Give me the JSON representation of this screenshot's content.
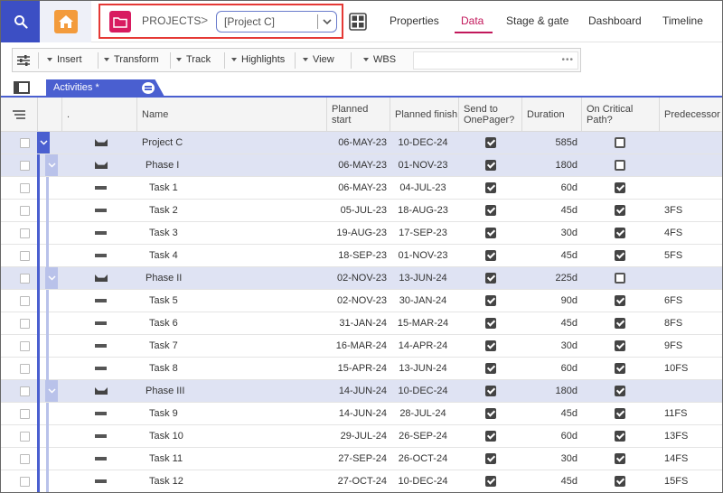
{
  "topbar": {
    "breadcrumb_root": "PROJECTS",
    "breadcrumb_sep": ">",
    "project_value": "[Project C]",
    "tabs": [
      {
        "label": "Properties",
        "active": false
      },
      {
        "label": "Data",
        "active": true
      },
      {
        "label": "Stage & gate",
        "active": false
      },
      {
        "label": "Dashboard",
        "active": false
      },
      {
        "label": "Timeline",
        "active": false
      }
    ]
  },
  "toolbar": {
    "items": [
      "Insert",
      "Transform",
      "Track",
      "Highlights",
      "View",
      "WBS"
    ],
    "more": "•••"
  },
  "sheet_tab": {
    "label": "Activities *"
  },
  "columns": {
    "dot": ".",
    "name": "Name",
    "planned_start": "Planned start",
    "planned_finish": "Planned finish",
    "send_to_onepager": "Send to OnePager?",
    "duration": "Duration",
    "critical_path": "On Critical Path?",
    "predecessor": "Predecessor"
  },
  "rows": [
    {
      "level": 0,
      "type": "summary",
      "name": "Project C",
      "start": "06-MAY-23",
      "finish": "10-DEC-24",
      "send": true,
      "duration": "585d",
      "critical": false,
      "pred": ""
    },
    {
      "level": 1,
      "type": "summary",
      "name": "Phase I",
      "start": "06-MAY-23",
      "finish": "01-NOV-23",
      "send": true,
      "duration": "180d",
      "critical": false,
      "pred": ""
    },
    {
      "level": 2,
      "type": "task",
      "name": "Task 1",
      "start": "06-MAY-23",
      "finish": "04-JUL-23",
      "send": true,
      "duration": "60d",
      "critical": true,
      "pred": ""
    },
    {
      "level": 2,
      "type": "task",
      "name": "Task 2",
      "start": "05-JUL-23",
      "finish": "18-AUG-23",
      "send": true,
      "duration": "45d",
      "critical": true,
      "pred": "3FS"
    },
    {
      "level": 2,
      "type": "task",
      "name": "Task 3",
      "start": "19-AUG-23",
      "finish": "17-SEP-23",
      "send": true,
      "duration": "30d",
      "critical": true,
      "pred": "4FS"
    },
    {
      "level": 2,
      "type": "task",
      "name": "Task 4",
      "start": "18-SEP-23",
      "finish": "01-NOV-23",
      "send": true,
      "duration": "45d",
      "critical": true,
      "pred": "5FS"
    },
    {
      "level": 1,
      "type": "summary",
      "name": "Phase II",
      "start": "02-NOV-23",
      "finish": "13-JUN-24",
      "send": true,
      "duration": "225d",
      "critical": false,
      "pred": ""
    },
    {
      "level": 2,
      "type": "task",
      "name": "Task 5",
      "start": "02-NOV-23",
      "finish": "30-JAN-24",
      "send": true,
      "duration": "90d",
      "critical": true,
      "pred": "6FS"
    },
    {
      "level": 2,
      "type": "task",
      "name": "Task 6",
      "start": "31-JAN-24",
      "finish": "15-MAR-24",
      "send": true,
      "duration": "45d",
      "critical": true,
      "pred": "8FS"
    },
    {
      "level": 2,
      "type": "task",
      "name": "Task 7",
      "start": "16-MAR-24",
      "finish": "14-APR-24",
      "send": true,
      "duration": "30d",
      "critical": true,
      "pred": "9FS"
    },
    {
      "level": 2,
      "type": "task",
      "name": "Task 8",
      "start": "15-APR-24",
      "finish": "13-JUN-24",
      "send": true,
      "duration": "60d",
      "critical": true,
      "pred": "10FS"
    },
    {
      "level": 1,
      "type": "summary",
      "name": "Phase III",
      "start": "14-JUN-24",
      "finish": "10-DEC-24",
      "send": true,
      "duration": "180d",
      "critical": true,
      "pred": ""
    },
    {
      "level": 2,
      "type": "task",
      "name": "Task 9",
      "start": "14-JUN-24",
      "finish": "28-JUL-24",
      "send": true,
      "duration": "45d",
      "critical": true,
      "pred": "11FS"
    },
    {
      "level": 2,
      "type": "task",
      "name": "Task 10",
      "start": "29-JUL-24",
      "finish": "26-SEP-24",
      "send": true,
      "duration": "60d",
      "critical": true,
      "pred": "13FS"
    },
    {
      "level": 2,
      "type": "task",
      "name": "Task 11",
      "start": "27-SEP-24",
      "finish": "26-OCT-24",
      "send": true,
      "duration": "30d",
      "critical": true,
      "pred": "14FS"
    },
    {
      "level": 2,
      "type": "task",
      "name": "Task 12",
      "start": "27-OCT-24",
      "finish": "10-DEC-24",
      "send": true,
      "duration": "45d",
      "critical": true,
      "pred": "15FS"
    }
  ],
  "colors": {
    "brand": "#3c4fc4",
    "accent": "#c2185b",
    "summary_row": "#dfe3f3",
    "home": "#f39b3c",
    "folder": "#d81b60"
  }
}
